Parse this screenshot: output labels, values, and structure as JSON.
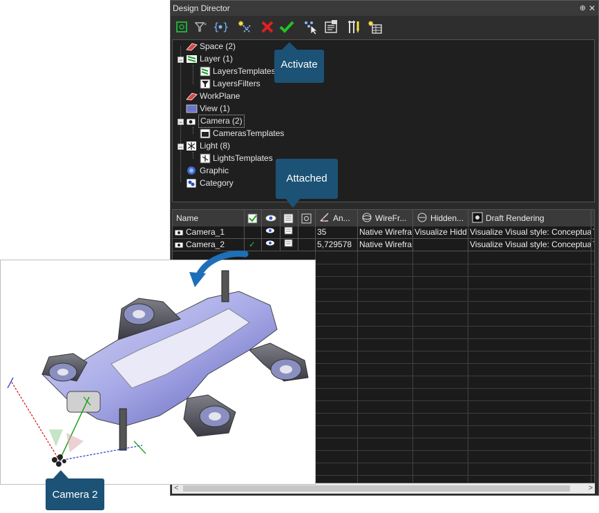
{
  "window": {
    "title": "Design Director",
    "pin_glyph": "⊕",
    "close_glyph": "✕"
  },
  "toolbar": {
    "items": [
      {
        "icon": "refresh-icon"
      },
      {
        "icon": "filter-icon"
      },
      {
        "icon": "select-all-icon"
      },
      {
        "icon": "new-icon"
      },
      {
        "icon": "delete-icon"
      },
      {
        "icon": "activate-icon"
      },
      {
        "icon": "pick-icon"
      },
      {
        "icon": "properties-icon"
      },
      {
        "icon": "tools-icon"
      },
      {
        "icon": "table-icon"
      }
    ]
  },
  "tree": {
    "items": [
      {
        "label": "Space (2)"
      },
      {
        "label": "Layer (1)"
      },
      {
        "label": "LayersTemplates"
      },
      {
        "label": "LayersFilters"
      },
      {
        "label": "WorkPlane"
      },
      {
        "label": "View (1)"
      },
      {
        "label": "Camera (2)"
      },
      {
        "label": "CamerasTemplates"
      },
      {
        "label": "Light (8)"
      },
      {
        "label": "LightsTemplates"
      },
      {
        "label": "Graphic"
      },
      {
        "label": "Category"
      }
    ],
    "expander_glyph": "−"
  },
  "grid": {
    "columns": [
      "Name",
      "",
      "",
      "",
      "",
      "An...",
      "WireFr...",
      "Hidden...",
      "Draft Rendering",
      ""
    ],
    "rows": [
      {
        "name": "Camera_1",
        "active": "",
        "angle": "35",
        "wireframe": "Native Wirefra",
        "hidden": "Visualize Hidd",
        "draft": "Visualize Visual style: Conceptua",
        "extra": "T"
      },
      {
        "name": "Camera_2",
        "active": "✓",
        "angle": "5,729578",
        "wireframe": "Native Wirefra",
        "hidden": "",
        "draft": "Visualize Visual style: Conceptua",
        "extra": "T"
      }
    ]
  },
  "scroll": {
    "left_arrow": "<",
    "right_arrow": ">"
  },
  "callouts": {
    "activate": "Activate",
    "attached": "Attached",
    "camera2": "Camera 2"
  },
  "colors": {
    "callout": "#1c5275",
    "panel_bg": "#2b2b2b",
    "check": "#22c322",
    "delete": "#e02020",
    "arrow": "#1e6fb8"
  }
}
